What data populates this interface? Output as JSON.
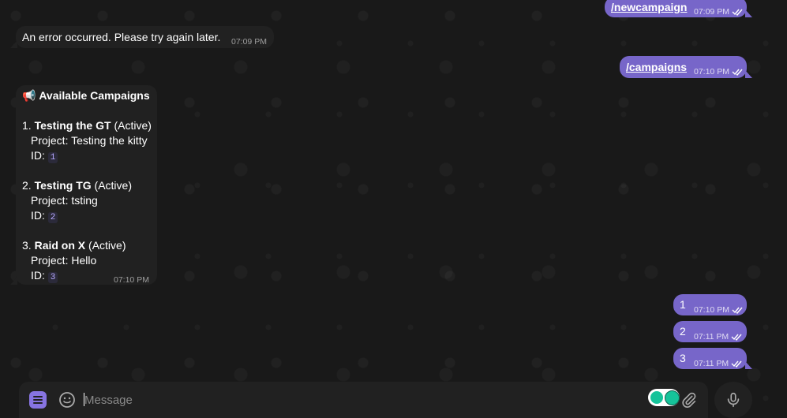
{
  "messages": {
    "newcampaign": {
      "text": "/newcampaign",
      "time": "07:09 PM"
    },
    "error": {
      "text": "An error occurred. Please try again later.",
      "time": "07:09 PM"
    },
    "campaigns_cmd": {
      "text": "/campaigns",
      "time": "07:10 PM"
    },
    "campaign_list": {
      "emoji": "📢",
      "title": "Available Campaigns",
      "time": "07:10 PM",
      "items": [
        {
          "num": "1.",
          "name": "Testing the GT",
          "status": "(Active)",
          "project": "Project: Testing the kitty",
          "id_label": "ID:",
          "id": "1"
        },
        {
          "num": "2.",
          "name": "Testing TG",
          "status": "(Active)",
          "project": "Project: tsting",
          "id_label": "ID:",
          "id": "2"
        },
        {
          "num": "3.",
          "name": "Raid on X",
          "status": "(Active)",
          "project": "Project: Hello",
          "id_label": "ID:",
          "id": "3"
        }
      ]
    },
    "reply1": {
      "text": "1",
      "time": "07:10 PM"
    },
    "reply2": {
      "text": "2",
      "time": "07:11 PM"
    },
    "reply3": {
      "text": "3",
      "time": "07:11 PM"
    }
  },
  "composer": {
    "placeholder": "Message",
    "icons": [
      "menu-icon",
      "emoji-icon",
      "grammarly-icon",
      "attach-icon",
      "microphone-icon"
    ]
  },
  "colors": {
    "outgoing": "#7766c9",
    "incoming": "#212121",
    "accent": "#8774e1"
  }
}
